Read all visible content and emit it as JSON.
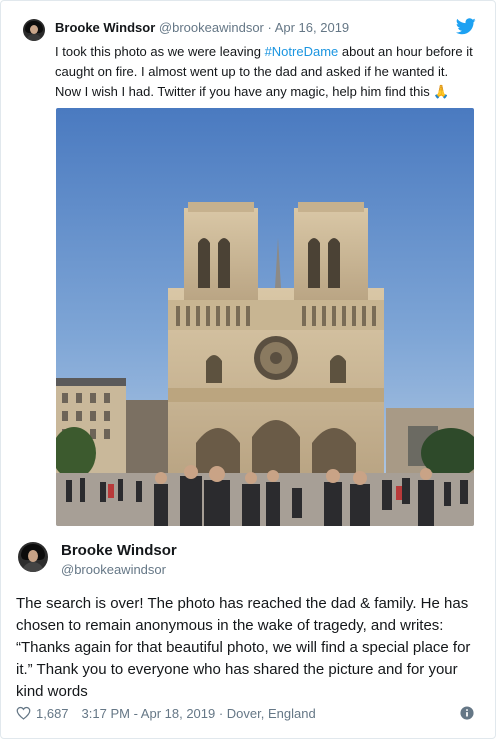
{
  "quoted_tweet": {
    "author_name": "Brooke Windsor",
    "meta": "@brookeawindsor · Apr 16, 2019",
    "text_before_hashtag": "I took this photo as we were leaving ",
    "hashtag": "#NotreDame",
    "text_after_hashtag": " about an hour before it caught on fire. I almost went up to the dad and asked if he wanted it. Now I wish I had. Twitter if you have any magic, help him find this ",
    "emoji": "🙏",
    "photo_icon": "notre-dame-photo",
    "brand_icon": "twitter-bird-icon",
    "brand_color": "#1da1f2"
  },
  "tweet": {
    "author_name": "Brooke Windsor",
    "handle": "@brookeawindsor",
    "text": "The search is over! The photo has reached the dad & family. He has chosen to remain anonymous in the wake of tragedy, and writes: “Thanks again for that beautiful photo, we will find a special place for it.” Thank you to everyone who has shared the picture and for your kind words",
    "likes": "1,687",
    "timestamp_location": "3:17 PM - Apr 18, 2019 · Dover, England"
  },
  "colors": {
    "text": "#14171a",
    "secondary": "#657786",
    "link": "#1b95e0"
  }
}
